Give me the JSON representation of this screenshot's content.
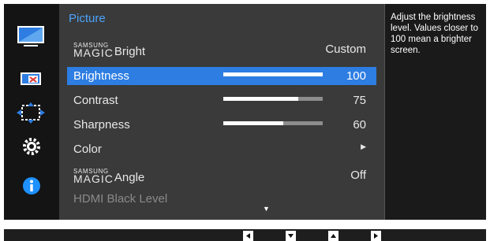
{
  "menu": {
    "title": "Picture",
    "items": [
      {
        "brand": "SAMSUNG",
        "magic": "MAGIC",
        "label": "Bright",
        "value": "Custom",
        "type": "value"
      },
      {
        "label": "Brightness",
        "value": "100",
        "level": 1.0,
        "type": "slider",
        "selected": true
      },
      {
        "label": "Contrast",
        "value": "75",
        "level": 0.75,
        "type": "slider"
      },
      {
        "label": "Sharpness",
        "value": "60",
        "level": 0.6,
        "type": "slider"
      },
      {
        "label": "Color",
        "type": "submenu"
      },
      {
        "brand": "SAMSUNG",
        "magic": "MAGIC",
        "label": "Angle",
        "value": "Off",
        "type": "value"
      },
      {
        "label": "HDMI Black Level",
        "type": "disabled"
      }
    ]
  },
  "help": {
    "text": "Adjust the brightness level. Values closer to 100 mean a brighter screen."
  },
  "sidebar": {
    "icons": [
      "picture-icon",
      "onscreen-display-icon",
      "position-size-icon",
      "setup-reset-icon",
      "information-icon"
    ],
    "info_color": "#1e90ff"
  },
  "buttons": [
    "left-button",
    "down-button",
    "up-button",
    "right-button"
  ],
  "colors": {
    "accent": "#2d7de2",
    "title": "#4aa3ff"
  }
}
